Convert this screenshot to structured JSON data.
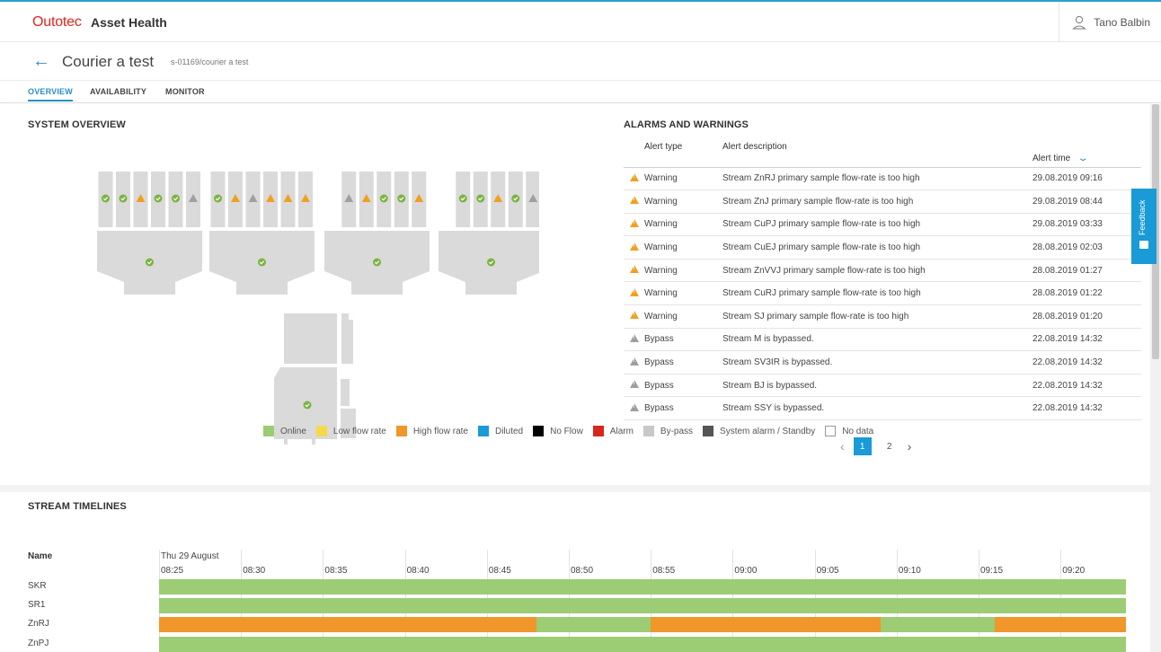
{
  "brand": {
    "logo": "Outotec",
    "app_name": "Asset Health"
  },
  "user": {
    "name": "Tano Balbin",
    "icon": "user-icon"
  },
  "page": {
    "title": "Courier a test",
    "subtitle": "s-01169/courier a test",
    "back_icon": "arrow-left-icon"
  },
  "tabs": [
    {
      "label": "OVERVIEW",
      "active": true
    },
    {
      "label": "AVAILABILITY",
      "active": false
    },
    {
      "label": "MONITOR",
      "active": false
    }
  ],
  "system_overview": {
    "title": "SYSTEM OVERVIEW",
    "units": [
      {
        "statuses": [
          "ok",
          "ok",
          "warning",
          "ok",
          "ok",
          "bypass"
        ],
        "hopper_status": "ok"
      },
      {
        "statuses": [
          "ok",
          "warning",
          "bypass",
          "warning",
          "warning",
          "warning"
        ],
        "hopper_status": "ok"
      },
      {
        "statuses": [
          "bypass",
          "warning",
          "ok",
          "ok",
          "warning"
        ],
        "hopper_status": "ok"
      },
      {
        "statuses": [
          "ok",
          "ok",
          "warning",
          "ok",
          "bypass"
        ],
        "hopper_status": "ok"
      }
    ],
    "cabinet_status": "ok"
  },
  "alarms": {
    "title": "ALARMS AND WARNINGS",
    "headers": {
      "type": "Alert type",
      "description": "Alert description",
      "time": "Alert time"
    },
    "rows": [
      {
        "level": "warning",
        "type": "Warning",
        "description": "Stream ZnRJ primary sample flow-rate is too high",
        "time": "29.08.2019 09:16"
      },
      {
        "level": "warning",
        "type": "Warning",
        "description": "Stream ZnJ primary sample flow-rate is too high",
        "time": "29.08.2019 08:44"
      },
      {
        "level": "warning",
        "type": "Warning",
        "description": "Stream CuPJ primary sample flow-rate is too high",
        "time": "29.08.2019 03:33"
      },
      {
        "level": "warning",
        "type": "Warning",
        "description": "Stream CuEJ primary sample flow-rate is too high",
        "time": "28.08.2019 02:03"
      },
      {
        "level": "warning",
        "type": "Warning",
        "description": "Stream ZnVVJ primary sample flow-rate is too high",
        "time": "28.08.2019 01:27"
      },
      {
        "level": "warning",
        "type": "Warning",
        "description": "Stream CuRJ primary sample flow-rate is too high",
        "time": "28.08.2019 01:22"
      },
      {
        "level": "warning",
        "type": "Warning",
        "description": "Stream SJ primary sample flow-rate is too high",
        "time": "28.08.2019 01:20"
      },
      {
        "level": "bypass",
        "type": "Bypass",
        "description": "Stream M is bypassed.",
        "time": "22.08.2019 14:32"
      },
      {
        "level": "bypass",
        "type": "Bypass",
        "description": "Stream SV3IR is bypassed.",
        "time": "22.08.2019 14:32"
      },
      {
        "level": "bypass",
        "type": "Bypass",
        "description": "Stream BJ is bypassed.",
        "time": "22.08.2019 14:32"
      },
      {
        "level": "bypass",
        "type": "Bypass",
        "description": "Stream SSY is bypassed.",
        "time": "22.08.2019 14:32"
      }
    ],
    "pagination": {
      "pages": [
        "1",
        "2"
      ],
      "current": "1"
    }
  },
  "timelines": {
    "title": "STREAM TIMELINES",
    "legend": [
      {
        "label": "Online",
        "color": "#9ccc74"
      },
      {
        "label": "Low flow rate",
        "color": "#f5d94a"
      },
      {
        "label": "High flow rate",
        "color": "#f0962a"
      },
      {
        "label": "Diluted",
        "color": "#1a9ad6"
      },
      {
        "label": "No Flow",
        "color": "#000000"
      },
      {
        "label": "Alarm",
        "color": "#d9261c"
      },
      {
        "label": "By-pass",
        "color": "#c8c8c8"
      },
      {
        "label": "System alarm / Standby",
        "color": "#555555"
      },
      {
        "label": "No data",
        "color": "#ffffff"
      }
    ],
    "name_header": "Name",
    "date": "Thu 29 August",
    "ticks": [
      "08:25",
      "08:30",
      "08:35",
      "08:40",
      "08:45",
      "08:50",
      "08:55",
      "09:00",
      "09:05",
      "09:10",
      "09:15",
      "09:20"
    ],
    "rows": [
      {
        "name": "SKR",
        "segments": [
          {
            "from": "08:25",
            "to": "09:24",
            "state": "Online"
          }
        ]
      },
      {
        "name": "SR1",
        "segments": [
          {
            "from": "08:25",
            "to": "09:24",
            "state": "Online"
          }
        ]
      },
      {
        "name": "ZnRJ",
        "segments": [
          {
            "from": "08:25",
            "to": "08:48",
            "state": "High flow rate"
          },
          {
            "from": "08:48",
            "to": "08:55",
            "state": "Online"
          },
          {
            "from": "08:55",
            "to": "09:09",
            "state": "High flow rate"
          },
          {
            "from": "09:09",
            "to": "09:16",
            "state": "Online"
          },
          {
            "from": "09:16",
            "to": "09:24",
            "state": "High flow rate"
          }
        ]
      },
      {
        "name": "ZnPJ",
        "segments": [
          {
            "from": "08:25",
            "to": "09:24",
            "state": "Online"
          }
        ]
      }
    ]
  }
}
